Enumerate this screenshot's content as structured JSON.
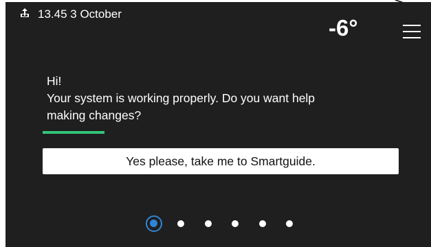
{
  "status_bar": {
    "upload_icon": "upload-icon",
    "datetime": "13.45 3 October",
    "outdoor_temperature": "-6°",
    "menu_icon": "hamburger-menu-icon"
  },
  "message": {
    "greeting": "Hi!",
    "line1": "Your system is working properly. Do you want help",
    "line2": "making changes?"
  },
  "action": {
    "label": "Yes please, take me to Smartguide."
  },
  "pager": {
    "page_count": 6,
    "active_page": 1
  },
  "colors": {
    "background": "#1f1f1f",
    "accent_green": "#33c47a",
    "active_page_blue": "#2f86d8",
    "text": "#ffffff"
  }
}
